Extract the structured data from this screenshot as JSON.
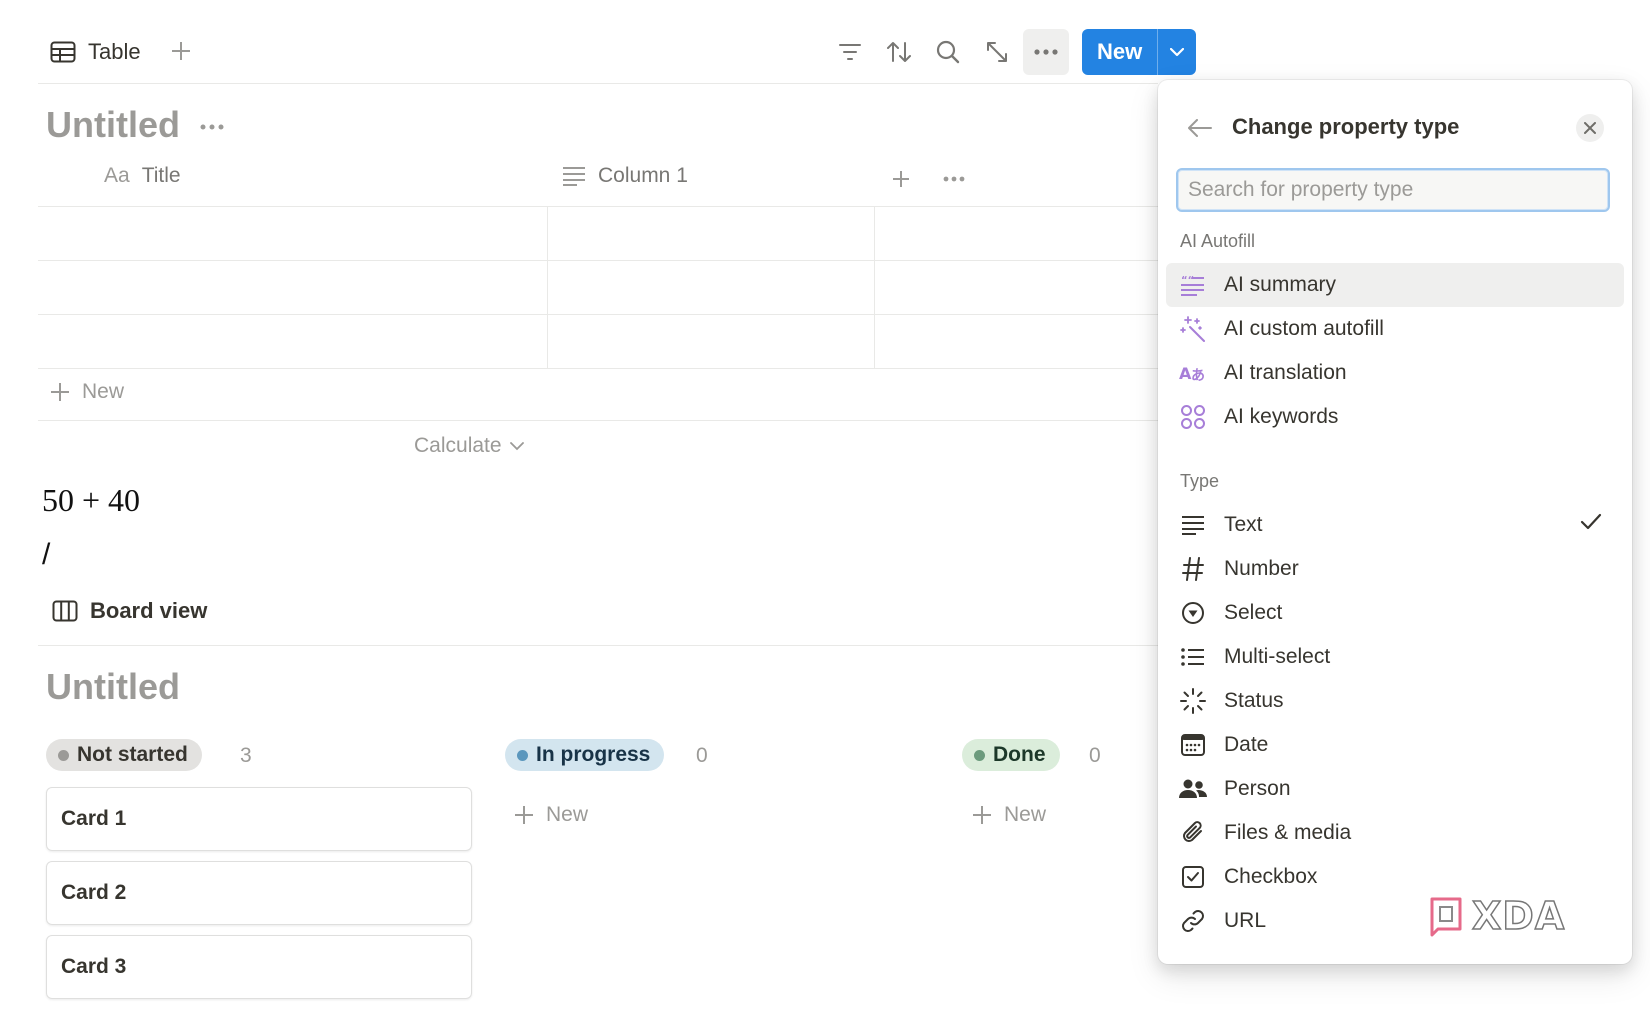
{
  "toolbar": {
    "view_tab_label": "Table",
    "new_button_label": "New",
    "icons": [
      "table-icon",
      "plus-icon",
      "filter-icon",
      "sort-icon",
      "search-icon",
      "expand-icon",
      "more-icon",
      "chevron-down-icon"
    ],
    "accent_color": "#2383e2"
  },
  "table_view": {
    "title": "Untitled",
    "columns": [
      {
        "name": "Title",
        "icon_text": "Aa"
      },
      {
        "name": "Column 1",
        "icon": "text-lines-icon"
      }
    ],
    "row_count": 3,
    "new_row_label": "New",
    "calculate_label": "Calculate"
  },
  "content": {
    "equation": "50 + 40",
    "slash": "/"
  },
  "board_view": {
    "tab_label": "Board view",
    "title": "Untitled",
    "groups": [
      {
        "label": "Not started",
        "count": "3",
        "color": "#9b9a97",
        "bg": "#e3e2e0"
      },
      {
        "label": "In progress",
        "count": "0",
        "color": "#5b97bd",
        "bg": "#d3e5ef"
      },
      {
        "label": "Done",
        "count": "0",
        "color": "#6c9b7d",
        "bg": "#dbeddb"
      }
    ],
    "cards": [
      "Card 1",
      "Card 2",
      "Card 3"
    ],
    "new_label": "New"
  },
  "popup": {
    "title": "Change property type",
    "search_placeholder": "Search for property type",
    "ai_section_label": "AI Autofill",
    "ai_options": [
      {
        "label": "AI summary",
        "icon": "ai-summary-icon"
      },
      {
        "label": "AI custom autofill",
        "icon": "sparkle-icon"
      },
      {
        "label": "AI translation",
        "icon": "translate-icon"
      },
      {
        "label": "AI keywords",
        "icon": "keywords-icon"
      }
    ],
    "type_section_label": "Type",
    "type_options": [
      {
        "label": "Text",
        "icon": "text-icon",
        "selected": true
      },
      {
        "label": "Number",
        "icon": "hash-icon"
      },
      {
        "label": "Select",
        "icon": "select-icon"
      },
      {
        "label": "Multi-select",
        "icon": "list-icon"
      },
      {
        "label": "Status",
        "icon": "status-icon"
      },
      {
        "label": "Date",
        "icon": "calendar-icon"
      },
      {
        "label": "Person",
        "icon": "people-icon"
      },
      {
        "label": "Files & media",
        "icon": "paperclip-icon"
      },
      {
        "label": "Checkbox",
        "icon": "checkbox-icon"
      },
      {
        "label": "URL",
        "icon": "link-icon"
      }
    ]
  },
  "watermark": {
    "text": "XDA"
  }
}
